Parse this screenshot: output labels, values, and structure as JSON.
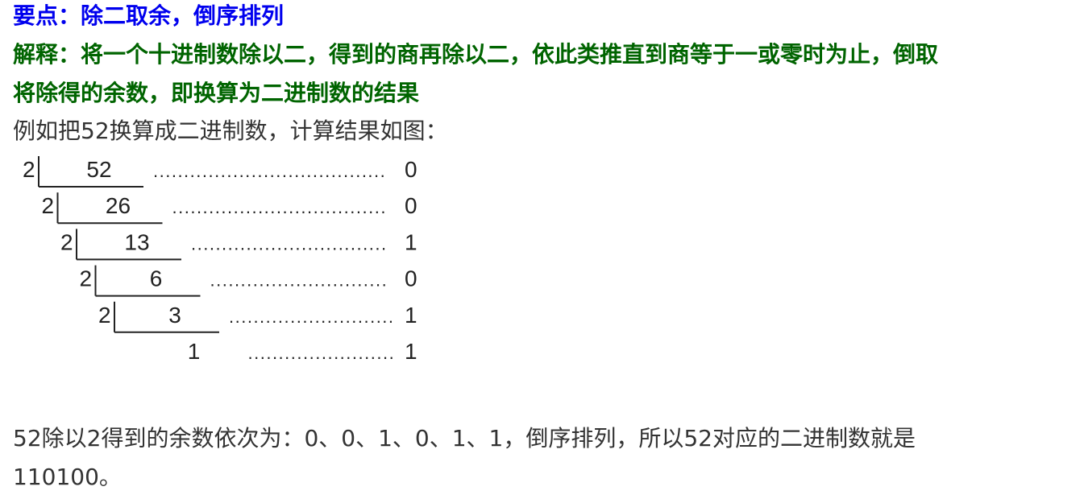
{
  "heading": "要点：除二取余，倒序排列",
  "explanation_line1": "解释：将一个十进制数除以二，得到的商再除以二，依此类推直到商等于一或零时为止，倒取",
  "explanation_line2": "将除得的余数，即换算为二进制数的结果",
  "example_intro": "例如把52换算成二进制数，计算结果如图：",
  "division_rows": [
    {
      "divisor": "2",
      "dividend": "52",
      "remainder": "0"
    },
    {
      "divisor": "2",
      "dividend": "26",
      "remainder": "0"
    },
    {
      "divisor": "2",
      "dividend": "13",
      "remainder": "1"
    },
    {
      "divisor": "2",
      "dividend": "6",
      "remainder": "0"
    },
    {
      "divisor": "2",
      "dividend": "3",
      "remainder": "1"
    },
    {
      "divisor": "",
      "dividend": "1",
      "remainder": "1"
    }
  ],
  "conclusion_line1": "52除以2得到的余数依次为：0、0、1、0、1、1，倒序排列，所以52对应的二进制数就是",
  "conclusion_line2": "110100。",
  "colors": {
    "heading": "#0000ee",
    "explanation": "#006400",
    "text": "#333333"
  }
}
